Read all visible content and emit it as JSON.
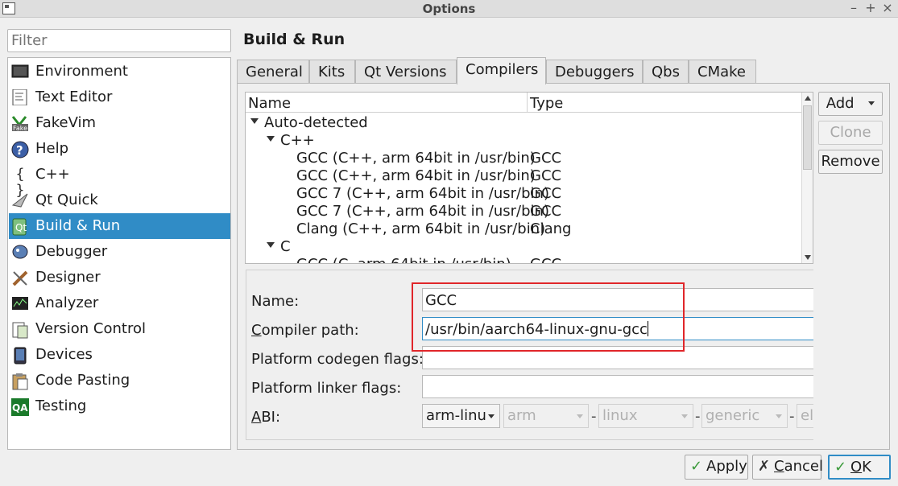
{
  "window": {
    "title": "Options"
  },
  "filter": {
    "placeholder": "Filter"
  },
  "sidebar": {
    "items": [
      {
        "label": "Environment",
        "icon": "monitor-icon"
      },
      {
        "label": "Text Editor",
        "icon": "text-editor-icon"
      },
      {
        "label": "FakeVim",
        "icon": "fakevim-icon"
      },
      {
        "label": "Help",
        "icon": "help-icon"
      },
      {
        "label": "C++",
        "icon": "cpp-braces-icon"
      },
      {
        "label": "Qt Quick",
        "icon": "qt-quick-icon"
      },
      {
        "label": "Build & Run",
        "icon": "build-run-icon",
        "selected": true
      },
      {
        "label": "Debugger",
        "icon": "debugger-icon"
      },
      {
        "label": "Designer",
        "icon": "designer-icon"
      },
      {
        "label": "Analyzer",
        "icon": "analyzer-icon"
      },
      {
        "label": "Version Control",
        "icon": "version-control-icon"
      },
      {
        "label": "Devices",
        "icon": "devices-icon"
      },
      {
        "label": "Code Pasting",
        "icon": "code-pasting-icon"
      },
      {
        "label": "Testing",
        "icon": "testing-qa-icon"
      }
    ]
  },
  "page": {
    "title": "Build & Run"
  },
  "tabs": [
    {
      "label": "General"
    },
    {
      "label": "Kits"
    },
    {
      "label": "Qt Versions"
    },
    {
      "label": "Compilers",
      "active": true
    },
    {
      "label": "Debuggers"
    },
    {
      "label": "Qbs"
    },
    {
      "label": "CMake"
    }
  ],
  "tree": {
    "columns": [
      "Name",
      "Type"
    ],
    "groups": {
      "auto": "Auto-detected",
      "cpp": "C++",
      "c": "C"
    },
    "rows": [
      {
        "name": "GCC (C++, arm 64bit in /usr/bin)",
        "type": "GCC"
      },
      {
        "name": "GCC (C++, arm 64bit in /usr/bin)",
        "type": "GCC"
      },
      {
        "name": "GCC 7 (C++, arm 64bit in /usr/bin)",
        "type": "GCC"
      },
      {
        "name": "GCC 7 (C++, arm 64bit in /usr/bin)",
        "type": "GCC"
      },
      {
        "name": "Clang (C++, arm 64bit in /usr/bin)",
        "type": "Clang"
      }
    ],
    "partial_row": {
      "name": "GCC (C, arm 64bit in /usr/bin)",
      "type": "GCC"
    }
  },
  "side_buttons": {
    "add": "Add",
    "clone": "Clone",
    "remove": "Remove"
  },
  "details": {
    "name_label": "Name:",
    "name_value": "GCC",
    "path_label_prefix": "C",
    "path_label_rest": "ompiler path:",
    "path_value": "/usr/bin/aarch64-linux-gnu-gcc",
    "codegen_label": "Platform codegen flags:",
    "codegen_value": "",
    "linker_label": "Platform linker flags:",
    "linker_value": "",
    "abi_label_prefix": "A",
    "abi_label_rest": "BI:",
    "abi": [
      "arm-linu",
      "arm",
      "linux",
      "generic",
      "el"
    ],
    "dash": "-"
  },
  "footer": {
    "apply": "Apply",
    "cancel_prefix": "C",
    "cancel_rest": "ancel",
    "ok_prefix": "O",
    "ok_rest": "K"
  },
  "colors": {
    "selection": "#308cc6",
    "highlight_box": "#e0262a"
  }
}
